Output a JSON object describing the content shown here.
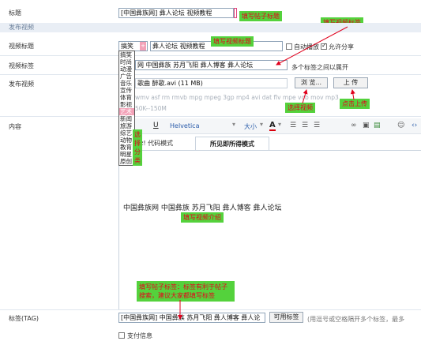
{
  "form": {
    "title_label": "标题",
    "title_value": "[中国彝族网] 彝人论坛 视频教程",
    "section_label": "发布视频",
    "video_title_label": "视频标题",
    "category_selected": "搞笑",
    "video_title_value": "彝人论坛 视频教程",
    "autoplay_label": "自动播放",
    "allow_share_label": "允许分享",
    "video_tags_label": "视频标签",
    "video_tags_value": "网 中国彝族 苏月飞阳 彝人博客 彝人论坛",
    "tags_hint": "多个标签之间以属开",
    "publish_video_label": "发布视频",
    "file_value": "歌曲 醉歌.avi (11 MB)",
    "browse_label": "浏 览...",
    "upload_label": "上 传",
    "formats_text": "wmv asf rm rmvb mpg mpeg 3gp mp4 avi dat flv mpe vob mov mp3",
    "size_text": "50K--150M",
    "content_label": "内容",
    "tag_label": "标签(TAG)",
    "tag_value": "[中国彝族网] 中国彝族 苏月飞阳 彝人博客 彝人论",
    "available_tags_label": "可用标签",
    "tag_hint": "(用逗号或空格隔开多个标签，最多",
    "bottom_partial": "支付信息"
  },
  "category_options": [
    "搞笑",
    "时尚",
    "动漫",
    "广告",
    "音乐",
    "宣传",
    "体育",
    "影视",
    "艺术",
    "新闻",
    "旅游",
    "综艺",
    "动物",
    "教育",
    "明星",
    "原创"
  ],
  "category_highlighted": "艺术",
  "editor": {
    "font_name": "Helvetica",
    "font_size": "大小",
    "underline": "U",
    "font_color": "A",
    "tab_code": "zz! 代码模式",
    "tab_wysiwyg": "所见即所得模式",
    "body_text": "中国彝族网  中国彝族  苏月飞阳  彝人博客  彝人论坛"
  },
  "notes": {
    "post_title": "填写帖子标题",
    "video_title": "填写视频标题",
    "video_tags": "填写视频标签",
    "select_video": "选择视频",
    "click_upload": "点击上传",
    "choose_category": "选择分类",
    "video_intro": "填写视频介绍",
    "post_tags": "填写帖子标签：标签有利于帖子搜索，建议大家都填写标签"
  },
  "colors": {
    "note_bg": "#54d23c",
    "note_text": "#e8001c",
    "arrow": "#e0001c",
    "section_bg": "#e9eef5"
  }
}
